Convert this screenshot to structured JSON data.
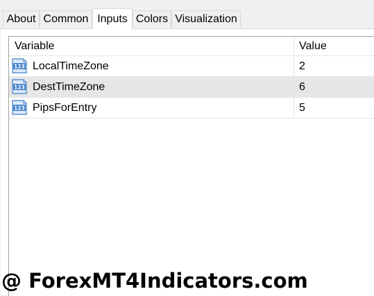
{
  "tabs": [
    {
      "label": "About"
    },
    {
      "label": "Common"
    },
    {
      "label": "Inputs",
      "active": true
    },
    {
      "label": "Colors"
    },
    {
      "label": "Visualization"
    }
  ],
  "grid": {
    "headers": {
      "variable": "Variable",
      "value": "Value"
    },
    "rows": [
      {
        "icon": "integer-type-icon",
        "icon_text": "123",
        "name": "LocalTimeZone",
        "value": "2",
        "selected": false
      },
      {
        "icon": "integer-type-icon",
        "icon_text": "123",
        "name": "DestTimeZone",
        "value": "6",
        "selected": true
      },
      {
        "icon": "integer-type-icon",
        "icon_text": "123",
        "name": "PipsForEntry",
        "value": "5",
        "selected": false
      }
    ]
  },
  "watermark": {
    "text": "@ ForexMT4Indicators.com"
  },
  "colors": {
    "icon_blue": "#3f7fc8",
    "icon_dark": "#1e4f8f",
    "selected_row": "#e6e6e6"
  }
}
